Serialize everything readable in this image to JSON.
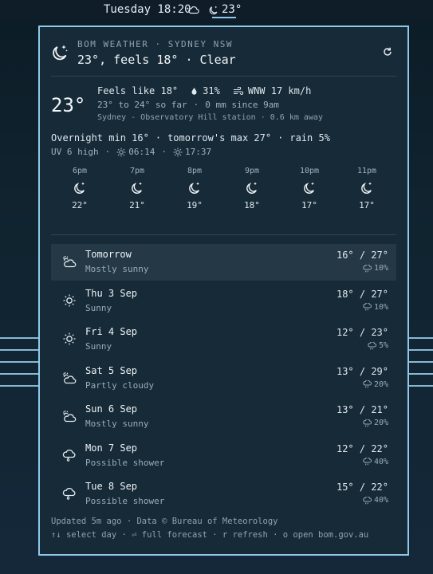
{
  "topbar": {
    "clock": "Tuesday 18:20",
    "temp": "23°"
  },
  "header": {
    "source": "BOM WEATHER · SYDNEY NSW",
    "title": "23°, feels 18° · Clear"
  },
  "current": {
    "temp": "23°",
    "feels": "Feels like 18°",
    "humidity": "31%",
    "wind": "WNW 17 km/h",
    "range": "23° to 24° so far",
    "rain_since": "0 mm since 9am",
    "station": "Sydney - Observatory Hill station · 0.6 km away",
    "overnight": "Overnight min 16°",
    "tomorrow_max": "tomorrow's max 27°",
    "rain_chance": "rain 5%",
    "uv": "UV 6 high",
    "sunrise": "06:14",
    "sunset": "17:37"
  },
  "hourly": [
    {
      "time": "6pm",
      "temp": "22°",
      "icon": "moon-stars-icon"
    },
    {
      "time": "7pm",
      "temp": "21°",
      "icon": "moon-stars-icon"
    },
    {
      "time": "8pm",
      "temp": "19°",
      "icon": "moon-stars-icon"
    },
    {
      "time": "9pm",
      "temp": "18°",
      "icon": "moon-stars-icon"
    },
    {
      "time": "10pm",
      "temp": "17°",
      "icon": "moon-stars-icon"
    },
    {
      "time": "11pm",
      "temp": "17°",
      "icon": "moon-stars-icon"
    }
  ],
  "days": [
    {
      "name": "Tomorrow",
      "cond": "Mostly sunny",
      "temps": "16° / 27°",
      "rain": "10%",
      "icon": "partly-sunny-icon"
    },
    {
      "name": "Thu 3 Sep",
      "cond": "Sunny",
      "temps": "18° / 27°",
      "rain": "10%",
      "icon": "sun-icon"
    },
    {
      "name": "Fri 4 Sep",
      "cond": "Sunny",
      "temps": "12° / 23°",
      "rain": "5%",
      "icon": "sun-icon"
    },
    {
      "name": "Sat 5 Sep",
      "cond": "Partly cloudy",
      "temps": "13° / 29°",
      "rain": "20%",
      "icon": "partly-sunny-icon"
    },
    {
      "name": "Sun 6 Sep",
      "cond": "Mostly sunny",
      "temps": "13° / 21°",
      "rain": "20%",
      "icon": "partly-sunny-icon"
    },
    {
      "name": "Mon 7 Sep",
      "cond": "Possible shower",
      "temps": "12° / 22°",
      "rain": "40%",
      "icon": "shower-icon"
    },
    {
      "name": "Tue 8 Sep",
      "cond": "Possible shower",
      "temps": "15° / 22°",
      "rain": "40%",
      "icon": "shower-icon"
    }
  ],
  "footer": {
    "updated": "Updated 5m ago · Data © Bureau of Meteorology",
    "hints": "↑↓ select day · ⏎ full forecast · r refresh · o open bom.gov.au"
  },
  "colors": {
    "accent": "#8fc9ea",
    "panel": "#172a37",
    "selected": "#243845"
  }
}
